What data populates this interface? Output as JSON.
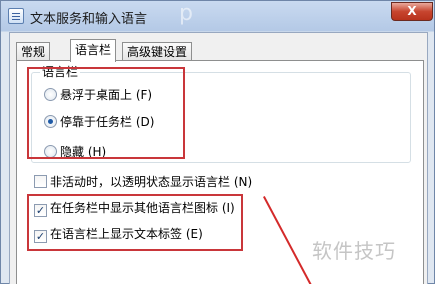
{
  "window": {
    "title": "文本服务和输入语言",
    "close_label": "X"
  },
  "tabs": [
    {
      "label": "常规",
      "active": false
    },
    {
      "label": "语言栏",
      "active": true
    },
    {
      "label": "高级键设置",
      "active": false
    }
  ],
  "language_bar_group": {
    "legend": "语言栏",
    "options": [
      {
        "label": "悬浮于桌面上 (F)",
        "checked": false
      },
      {
        "label": "停靠于任务栏 (D)",
        "checked": true
      },
      {
        "label": "隐藏 (H)",
        "checked": false
      }
    ]
  },
  "checkboxes": [
    {
      "label": "非活动时，以透明状态显示语言栏 (N)",
      "checked": false
    },
    {
      "label": "在任务栏中显示其他语言栏图标 (I)",
      "checked": true
    },
    {
      "label": "在语言栏上显示文本标签 (E)",
      "checked": true
    }
  ],
  "watermark": {
    "text": "软件技巧",
    "top_text": "p"
  },
  "annotation_color": "#c9363a"
}
